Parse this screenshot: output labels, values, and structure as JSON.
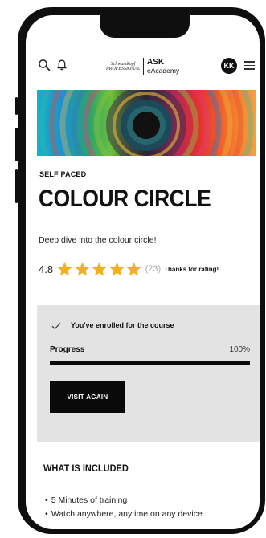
{
  "header": {
    "brand_small": "Schwarzkopf PROFESSIONAL",
    "brand_main": "ASK",
    "brand_sub": "eAcademy",
    "avatar_initials": "KK",
    "icons": [
      "search-icon",
      "bell-icon",
      "hamburger-icon"
    ]
  },
  "course": {
    "type_label": "SELF PACED",
    "title": "COLOUR CIRCLE",
    "description": "Deep dive into the colour circle!",
    "rating_value": "4.8",
    "rating_stars": 5,
    "rating_count": "(23)",
    "rating_thanks": "Thanks for rating!"
  },
  "enrollment": {
    "status": "You've enrolled for the course",
    "progress_label": "Progress",
    "progress_percent": "100%",
    "progress_fraction": 1.0,
    "button_label": "VISIT AGAIN"
  },
  "included": {
    "title": "WHAT IS INCLUDED",
    "items": [
      "5 Minutes of training",
      "Watch anywhere, anytime on any device"
    ]
  },
  "colors": {
    "star": "#f2b01e",
    "button": "#0a0a0a",
    "panel": "#e3e3e3"
  }
}
